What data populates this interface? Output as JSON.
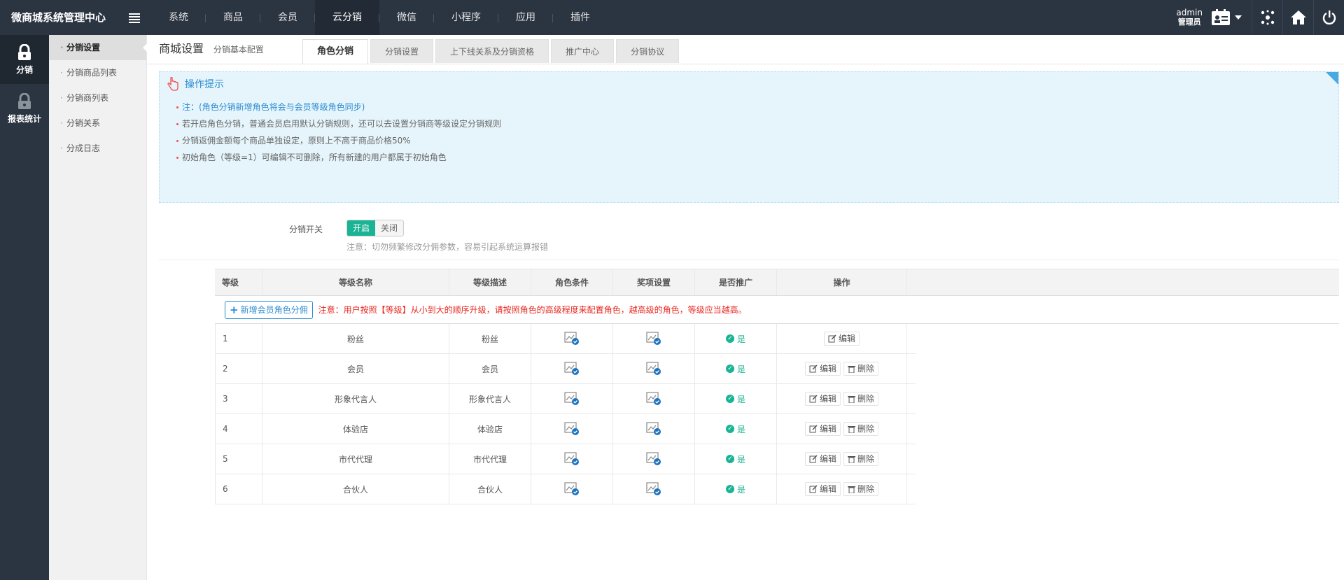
{
  "app": {
    "title": "微商城系统管理中心"
  },
  "topnav": [
    {
      "label": "系统"
    },
    {
      "label": "商品"
    },
    {
      "label": "会员"
    },
    {
      "label": "云分销"
    },
    {
      "label": "微信"
    },
    {
      "label": "小程序"
    },
    {
      "label": "应用"
    },
    {
      "label": "插件"
    }
  ],
  "user": {
    "name": "admin",
    "role": "管理员"
  },
  "sidebar": [
    {
      "label": "分销",
      "icon": "lock-icon"
    },
    {
      "label": "报表统计",
      "icon": "lock-icon"
    }
  ],
  "subnav": [
    {
      "label": "分销设置"
    },
    {
      "label": "分销商品列表"
    },
    {
      "label": "分销商列表"
    },
    {
      "label": "分销关系"
    },
    {
      "label": "分成日志"
    }
  ],
  "breadcrumb": {
    "title": "商城设置",
    "sub": "分销基本配置"
  },
  "tabs": [
    {
      "label": "角色分销"
    },
    {
      "label": "分销设置"
    },
    {
      "label": "上下线关系及分销资格"
    },
    {
      "label": "推广中心"
    },
    {
      "label": "分销协议"
    }
  ],
  "tips": {
    "title": "操作提示",
    "items": [
      "注：(角色分销新增角色将会与会员等级角色同步)",
      "若开启角色分销，普通会员启用默认分销规则，还可以去设置分销商等级设定分销规则",
      "分销返佣金额每个商品单独设定，原则上不高于商品价格50%",
      "初始角色（等级=1）可编辑不可删除，所有新建的用户都属于初始角色"
    ]
  },
  "switch": {
    "label": "分销开关",
    "on": "开启",
    "off": "关闭",
    "note": "注意：切勿频繁修改分佣参数，容易引起系统运算报错"
  },
  "table": {
    "headers": [
      "等级",
      "等级名称",
      "等级描述",
      "角色条件",
      "奖项设置",
      "是否推广",
      "操作"
    ],
    "add_button": "新增会员角色分佣",
    "add_note": "注意：用户按照【等级】从小到大的顺序升级，请按照角色的高级程度来配置角色，越高级的角色，等级应当越高。",
    "edit": "编辑",
    "delete": "删除",
    "rows": [
      {
        "level": "1",
        "name": "粉丝",
        "desc": "粉丝",
        "promote": "是"
      },
      {
        "level": "2",
        "name": "会员",
        "desc": "会员",
        "promote": "是"
      },
      {
        "level": "3",
        "name": "形象代言人",
        "desc": "形象代言人",
        "promote": "是"
      },
      {
        "level": "4",
        "name": "体验店",
        "desc": "体验店",
        "promote": "是"
      },
      {
        "level": "5",
        "name": "市代代理",
        "desc": "市代代理",
        "promote": "是"
      },
      {
        "level": "6",
        "name": "合伙人",
        "desc": "合伙人",
        "promote": "是"
      }
    ]
  },
  "colors": {
    "topbar": "#2b3441",
    "accent": "#1ab394",
    "link": "#2a8bd2",
    "warn": "#e8251e"
  }
}
